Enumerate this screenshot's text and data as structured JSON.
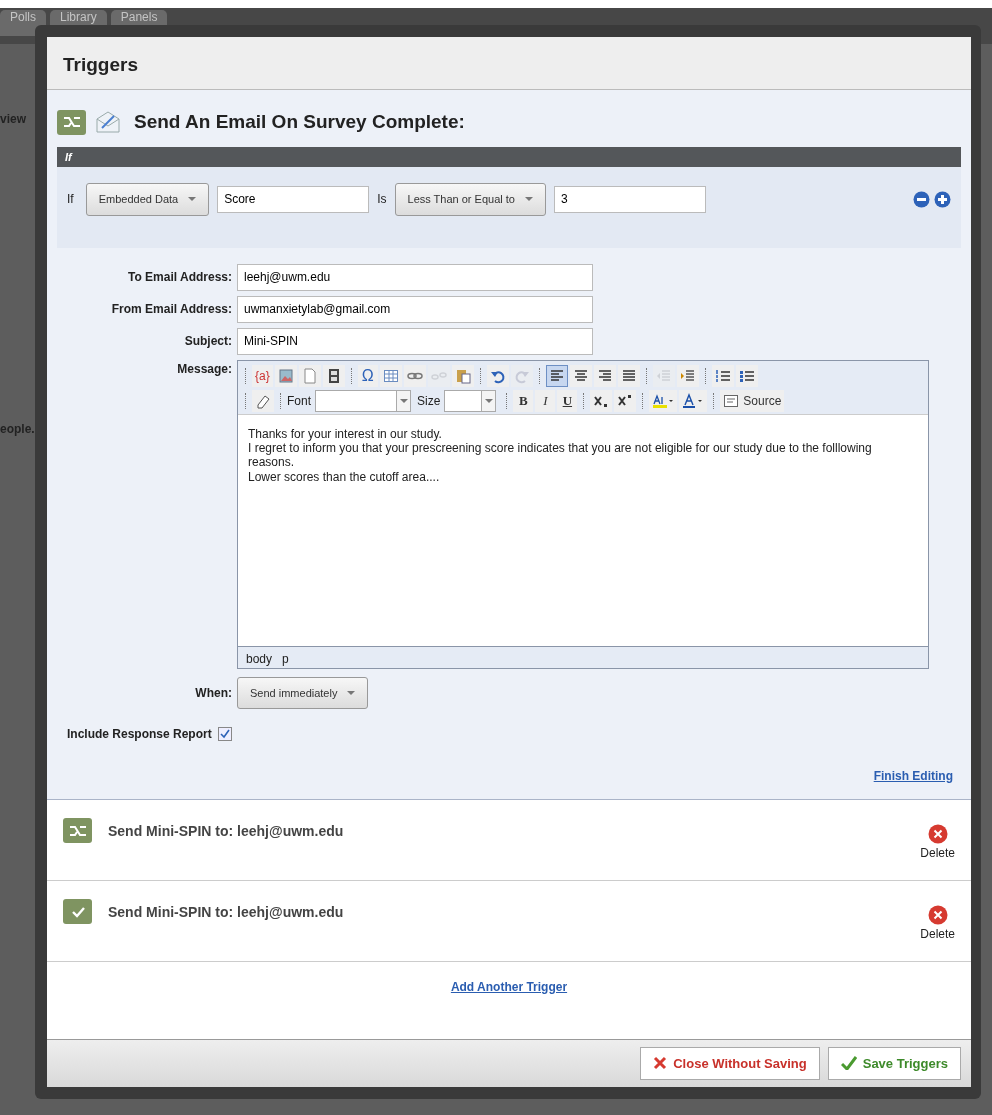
{
  "background": {
    "tabs": [
      "Polls",
      "Library",
      "Panels"
    ],
    "texts": [
      "view",
      "eople."
    ]
  },
  "dialog": {
    "title": "Triggers",
    "editor": {
      "heading": "Send An Email On Survey Complete:",
      "if_bar": "If",
      "condition": {
        "label": "If",
        "field": "Embedded Data",
        "value": "Score",
        "is": "Is",
        "operator": "Less Than or Equal to",
        "operand": "3"
      },
      "fields": [
        {
          "label": "To Email Address:",
          "value": "leehj@uwm.edu"
        },
        {
          "label": "From Email Address:",
          "value": "uwmanxietylab@gmail.com"
        },
        {
          "label": "Subject:",
          "value": "Mini-SPIN"
        }
      ],
      "message_label": "Message:",
      "toolbar": [
        [
          {
            "kind": "text",
            "label": "{a}"
          },
          {
            "kind": "image"
          },
          {
            "kind": "page"
          },
          {
            "kind": "film"
          },
          {
            "kind": "sep"
          },
          {
            "kind": "text",
            "label": "Ω"
          },
          {
            "kind": "table"
          },
          {
            "kind": "link"
          },
          {
            "kind": "unlink",
            "disabled": true
          },
          {
            "kind": "paste"
          },
          {
            "kind": "sep"
          },
          {
            "kind": "undo"
          },
          {
            "kind": "redo",
            "disabled": true
          },
          {
            "kind": "sep"
          },
          {
            "kind": "align-left",
            "selected": true
          },
          {
            "kind": "align-center",
            "selected": false
          },
          {
            "kind": "align-right",
            "selected": false
          },
          {
            "kind": "justify",
            "selected": false
          },
          {
            "kind": "sep"
          },
          {
            "kind": "outdent",
            "disabled": true
          },
          {
            "kind": "indent"
          },
          {
            "kind": "sep"
          },
          {
            "kind": "numbered"
          },
          {
            "kind": "bulleted"
          }
        ],
        [
          {
            "kind": "eraser"
          },
          {
            "kind": "sep"
          },
          {
            "kind": "combo",
            "label": "Font"
          },
          {
            "kind": "combo",
            "label": "Size"
          },
          {
            "kind": "sep"
          },
          {
            "kind": "text",
            "label": "B"
          },
          {
            "kind": "text",
            "label": "I"
          },
          {
            "kind": "text",
            "label": "U"
          },
          {
            "kind": "sep"
          },
          {
            "kind": "subscript"
          },
          {
            "kind": "superscript"
          },
          {
            "kind": "sep"
          },
          {
            "kind": "highlight"
          },
          {
            "kind": "textcolor"
          },
          {
            "kind": "sep"
          },
          {
            "kind": "source",
            "label": "Source"
          }
        ]
      ],
      "message": [
        "Thanks for your interest in our study.",
        "I regret to inform you that your prescreening score indicates that you are not eligible for our study due to the folllowing reasons.",
        "Lower scores than the cutoff area...."
      ],
      "path": [
        "body",
        "p"
      ],
      "when_label": "When:",
      "when": "Send immediately",
      "report_label": "Include Response Report",
      "report_checked": true,
      "finish": "Finish Editing"
    },
    "triggers": [
      {
        "kind": "condition",
        "text": "Send Mini-SPIN to: leehj@uwm.edu",
        "delete": "Delete"
      },
      {
        "kind": "check",
        "text": "Send Mini-SPIN to: leehj@uwm.edu",
        "delete": "Delete"
      }
    ],
    "add": "Add Another Trigger",
    "buttons": [
      {
        "kind": "cancel",
        "label": "Close Without Saving"
      },
      {
        "kind": "save",
        "label": "Save Triggers"
      }
    ]
  }
}
